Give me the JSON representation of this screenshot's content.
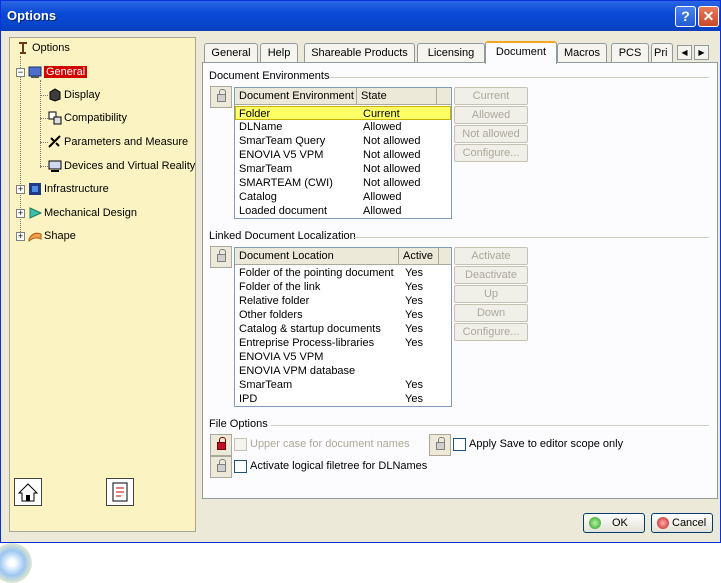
{
  "window": {
    "title": "Options",
    "help_symbol": "?",
    "close_symbol": "✕"
  },
  "tree": {
    "root": "Options",
    "items": [
      {
        "label": "General"
      },
      {
        "label": "Display"
      },
      {
        "label": "Compatibility"
      },
      {
        "label": "Parameters and Measure"
      },
      {
        "label": "Devices and Virtual Reality"
      },
      {
        "label": "Infrastructure"
      },
      {
        "label": "Mechanical Design"
      },
      {
        "label": "Shape"
      }
    ]
  },
  "tabs": [
    {
      "label": "General"
    },
    {
      "label": "Help"
    },
    {
      "label": "Shareable Products"
    },
    {
      "label": "Licensing"
    },
    {
      "label": "Document"
    },
    {
      "label": "Macros"
    },
    {
      "label": "PCS"
    },
    {
      "label": "Pri"
    }
  ],
  "active_tab": "Document",
  "document_environments": {
    "title": "Document Environments",
    "columns": [
      "Document Environment",
      "State"
    ],
    "rows": [
      {
        "env": "Folder",
        "state": "Current"
      },
      {
        "env": "DLName",
        "state": "Allowed"
      },
      {
        "env": "SmarTeam Query",
        "state": "Not allowed"
      },
      {
        "env": "ENOVIA V5 VPM",
        "state": "Not allowed"
      },
      {
        "env": "SmarTeam",
        "state": "Not allowed"
      },
      {
        "env": "SMARTEAM (CWI)",
        "state": "Not allowed"
      },
      {
        "env": "Catalog",
        "state": "Allowed"
      },
      {
        "env": "Loaded document",
        "state": "Allowed"
      }
    ],
    "buttons": [
      "Current",
      "Allowed",
      "Not allowed",
      "Configure..."
    ]
  },
  "linked_localization": {
    "title": "Linked Document Localization",
    "columns": [
      "Document Location",
      "Active"
    ],
    "rows": [
      {
        "loc": "Folder of the pointing document",
        "active": "Yes"
      },
      {
        "loc": "Folder of the link",
        "active": "Yes"
      },
      {
        "loc": "Relative folder",
        "active": "Yes"
      },
      {
        "loc": "Other folders",
        "active": "Yes"
      },
      {
        "loc": "Catalog & startup documents",
        "active": "Yes"
      },
      {
        "loc": "Entreprise Process-libraries",
        "active": "Yes"
      },
      {
        "loc": "ENOVIA V5 VPM",
        "active": ""
      },
      {
        "loc": "ENOVIA VPM  database",
        "active": ""
      },
      {
        "loc": "SmarTeam",
        "active": "Yes"
      },
      {
        "loc": "IPD",
        "active": "Yes"
      }
    ],
    "buttons": [
      "Activate",
      "Deactivate",
      "Up",
      "Down",
      "Configure..."
    ]
  },
  "file_options": {
    "title": "File Options",
    "upper_case": "Upper case for document names",
    "apply_save": "Apply Save to editor scope only",
    "logical_filetree": "Activate logical filetree for DLNames"
  },
  "footer": {
    "ok": "OK",
    "cancel": "Cancel"
  },
  "colors": {
    "title_bar": "#0a4ad6",
    "tree_bg": "#fbf4c2",
    "highlight_row": "#ffff66",
    "active_tab_accent": "#f5a623"
  }
}
